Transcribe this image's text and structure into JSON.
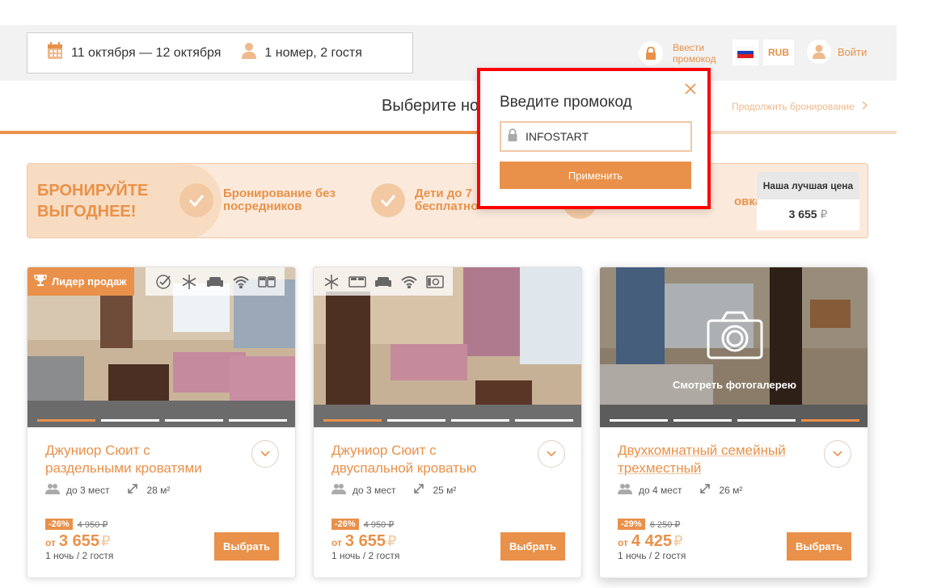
{
  "search": {
    "dates": "11 октября — 12 октября",
    "guests": "1 номер, 2 гостя"
  },
  "header": {
    "promo_label_line1": "Ввести",
    "promo_label_line2": "промокод",
    "currency": "RUB",
    "login": "Войти"
  },
  "step": {
    "title": "Выберите номер",
    "continue": "Продолжить бронирование"
  },
  "banner": {
    "title_line1": "БРОНИРУЙТЕ",
    "title_line2": "ВЫГОДНЕЕ!",
    "features": [
      {
        "line1": "Бронирование без",
        "line2": "посредников"
      },
      {
        "line1": "Дети до 7",
        "line2": "бесплатно"
      },
      {
        "line1": "",
        "line2": "овка"
      }
    ],
    "best_price_label": "Наша лучшая цена",
    "best_price_value": "3 655",
    "rub": "₽"
  },
  "popup": {
    "title": "Введите промокод",
    "input_value": "INFOSTART",
    "apply": "Применить"
  },
  "rooms": [
    {
      "badge": "Лидер продаж",
      "title_line1": "Джуниор Сюит с",
      "title_line2": "раздельными кроватями",
      "capacity": "до 3 мест",
      "area": "28 м²",
      "discount": "-26%",
      "old_price": "4 950 ₽",
      "from": "от",
      "price": "3 655",
      "rub": "₽",
      "per_night": "1 ночь / 2 гостя",
      "select": "Выбрать"
    },
    {
      "title_line1": "Джуниор Сюит с",
      "title_line2": "двуспальной кроватью",
      "capacity": "до 3 мест",
      "area": "25 м²",
      "discount": "-26%",
      "old_price": "4 950 ₽",
      "from": "от",
      "price": "3 655",
      "rub": "₽",
      "per_night": "1 ночь / 2 гостя",
      "select": "Выбрать"
    },
    {
      "gallery": "Смотреть фотогалерею",
      "title_line1": "Двухкомнатный семейный",
      "title_line2": "трехместный",
      "capacity": "до 4 мест",
      "area": "26 м²",
      "discount": "-29%",
      "old_price": "6 250 ₽",
      "from": "от",
      "price": "4 425",
      "rub": "₽",
      "per_night": "1 ночь / 2 гостя",
      "select": "Выбрать"
    }
  ],
  "colors": {
    "accent": "#e9914a",
    "accent_light": "#f3c59d",
    "highlight_border": "#ff0000"
  }
}
